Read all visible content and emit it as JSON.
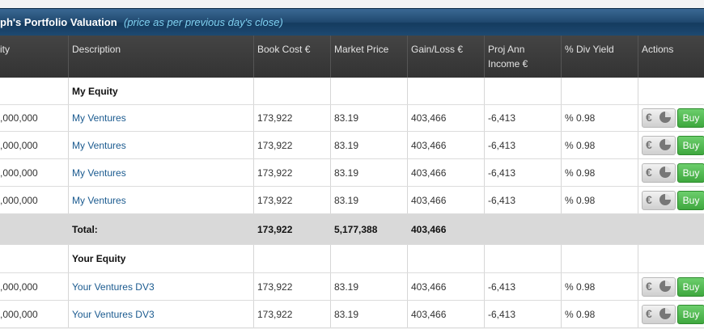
{
  "title": "ph's Portfolio Valuation",
  "subtitle": "(price as per previous day's close)",
  "columns": [
    "ity",
    "Description",
    "Book Cost €",
    "Market Price",
    "Gain/Loss €",
    "Proj Ann Income €",
    "% Div Yield",
    "Actions"
  ],
  "groups": [
    {
      "name": "My Equity",
      "rows": [
        {
          "qty": ",000,000",
          "desc": "My Ventures",
          "book": "173,922",
          "price": "83.19",
          "gain": "403,466",
          "income": "-6,413",
          "yield": "% 0.98",
          "buy": "Buy"
        },
        {
          "qty": ",000,000",
          "desc": "My Ventures",
          "book": "173,922",
          "price": "83.19",
          "gain": "403,466",
          "income": "-6,413",
          "yield": "% 0.98",
          "buy": "Buy"
        },
        {
          "qty": ",000,000",
          "desc": "My Ventures",
          "book": "173,922",
          "price": "83.19",
          "gain": "403,466",
          "income": "-6,413",
          "yield": "% 0.98",
          "buy": "Buy"
        },
        {
          "qty": ",000,000",
          "desc": "My Ventures",
          "book": "173,922",
          "price": "83.19",
          "gain": "403,466",
          "income": "-6,413",
          "yield": "% 0.98",
          "buy": "Buy"
        }
      ],
      "total": {
        "label": "Total:",
        "book": "173,922",
        "price": "5,177,388",
        "gain": "403,466"
      }
    },
    {
      "name": "Your Equity",
      "rows": [
        {
          "qty": ",000,000",
          "desc": "Your Ventures DV3",
          "book": "173,922",
          "price": "83.19",
          "gain": "403,466",
          "income": "-6,413",
          "yield": "% 0.98",
          "buy": "Buy"
        },
        {
          "qty": ",000,000",
          "desc": "Your Ventures DV3",
          "book": "173,922",
          "price": "83.19",
          "gain": "403,466",
          "income": "-6,413",
          "yield": "% 0.98",
          "buy": "Buy"
        }
      ]
    }
  ],
  "icons": {
    "value": "euro-icon",
    "chart": "pie-chart-icon"
  }
}
